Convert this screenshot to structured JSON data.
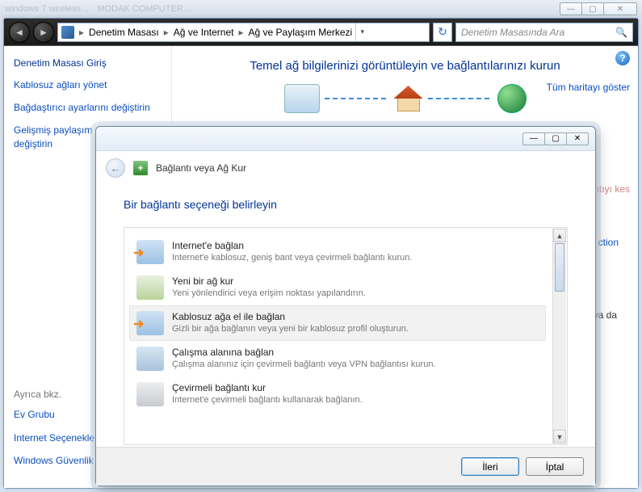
{
  "window_controls": {
    "min": "—",
    "max": "▢",
    "close": "✕"
  },
  "toptabs": {
    "t1": "windows 7 wireless ...",
    "t2": "MODAK COMPUTER ..."
  },
  "nav": {
    "crumb1": "Denetim Masası",
    "crumb2": "Ağ ve Internet",
    "crumb3": "Ağ ve Paylaşım Merkezi",
    "search_placeholder": "Denetim Masasında Ara"
  },
  "sidebar": {
    "home": "Denetim Masası Giriş",
    "links": [
      "Kablosuz ağları yönet",
      "Bağdaştırıcı ayarlarını değiştirin",
      "Gelişmiş paylaşım ayarlarını değiştirin"
    ],
    "see_also_label": "Ayrıca bkz.",
    "see_also": [
      "Ev Grubu",
      "Internet Seçenekleri",
      "Windows Güvenlik Duvarı"
    ]
  },
  "main": {
    "title": "Temel ağ bilgilerinizi görüntüleyin ve bağlantılarınızı kurun",
    "map_link": "Tüm haritayı göster",
    "disconnect": "Bağlantıyı kes",
    "action": "ction",
    "yada": "ya da"
  },
  "wizard": {
    "title": "Bağlantı veya Ağ Kur",
    "heading": "Bir bağlantı seçeneği belirleyin",
    "options": [
      {
        "t": "Internet'e bağlan",
        "d": "Internet'e kablosuz, geniş bant veya çevirmeli bağlantı kurun.",
        "icon": "arrow"
      },
      {
        "t": "Yeni bir ağ kur",
        "d": "Yeni yönlendirici veya erişim noktası yapılandırın.",
        "icon": "router"
      },
      {
        "t": "Kablosuz ağa el ile bağlan",
        "d": "Gizli bir ağa bağlanın veya yeni bir kablosuz profil oluşturun.",
        "icon": "arrow",
        "selected": true
      },
      {
        "t": "Çalışma alanına bağlan",
        "d": "Çalışma alanınız için çevirmeli bağlantı veya VPN bağlantısı kurun.",
        "icon": "work"
      },
      {
        "t": "Çevirmeli bağlantı kur",
        "d": "Internet'e çevirmeli bağlantı kullanarak bağlanın.",
        "icon": "dial"
      }
    ],
    "next": "İleri",
    "cancel": "İptal"
  }
}
